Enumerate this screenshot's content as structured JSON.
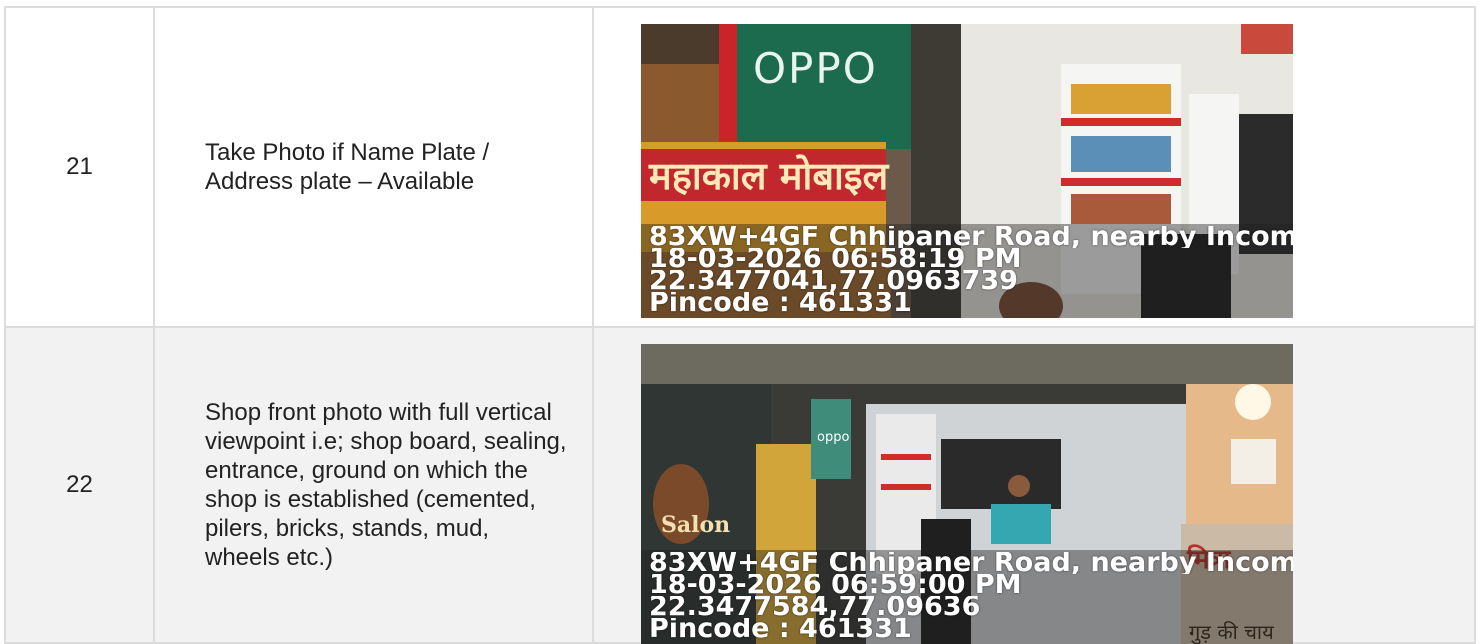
{
  "rows": [
    {
      "number": "21",
      "description": "Take Photo if Name Plate / Address plate – Available",
      "photo": {
        "address": "83XW+4GF Chhipaner Road, nearby Income",
        "datetime": "18-03-2026 06:58:19 PM",
        "coordinates": "22.3477041,77.0963739",
        "pincode": "Pincode : 461331",
        "sign_brand": "OPPO",
        "sign_shop": "महाकाल मोबाइल"
      }
    },
    {
      "number": "22",
      "description": "Shop front photo with full vertical viewpoint i.e; shop board, sealing, entrance, ground on which the shop is established (cemented, pilers, bricks, stands, mud, wheels etc.)",
      "photo": {
        "address": "83XW+4GF Chhipaner Road, nearby Income",
        "datetime": "18-03-2026 06:59:00 PM",
        "coordinates": "22.3477584,77.09636",
        "pincode": "Pincode : 461331",
        "sign_brand": "oppo",
        "sign_salon": "Salon",
        "sign_tea": "गुड़ की चाय",
        "sign_mitra": "मित्रा"
      }
    }
  ]
}
